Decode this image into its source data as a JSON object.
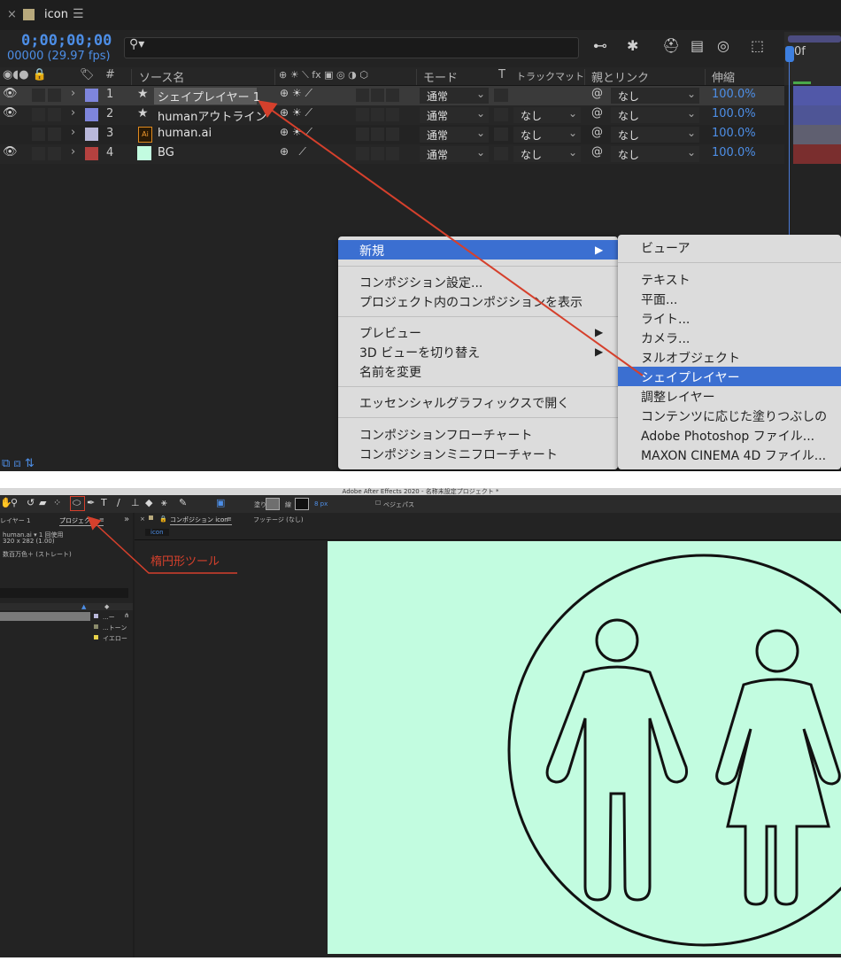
{
  "top_panel": {
    "tab": {
      "close": "×",
      "title": "icon",
      "menu": "☰"
    },
    "timecode": "0;00;00;00",
    "fps": "00000 (29.97 fps)",
    "search_placeholder": "",
    "timeline_label": "0f",
    "columns": {
      "switch_icons": "◉◖● 🔒",
      "label_icon": "🏷",
      "hash": "#",
      "source_name": "ソース名",
      "switches": "⊕ ☀ ⟍ fx ▣ ◎ ◑ ⬡",
      "mode": "モード",
      "t": "T",
      "track_matte": "トラックマット",
      "parent": "親とリンク",
      "stretch": "伸縮"
    },
    "layers": [
      {
        "num": "1",
        "name": "シェイプレイヤー 1",
        "type_icon": "★",
        "label_color": "#7e85dc",
        "mode": "通常",
        "matte": "",
        "parent": "なし",
        "stretch": "100.0%",
        "visible": true
      },
      {
        "num": "2",
        "name": "humanアウトライン",
        "type_icon": "★",
        "label_color": "#7e85dc",
        "mode": "通常",
        "matte": "なし",
        "parent": "なし",
        "stretch": "100.0%",
        "visible": true
      },
      {
        "num": "3",
        "name": "human.ai",
        "type_icon": "Ai",
        "label_color": "#b9b8da",
        "mode": "通常",
        "matte": "なし",
        "parent": "なし",
        "stretch": "100.0%",
        "visible": false
      },
      {
        "num": "4",
        "name": "BG",
        "type_icon": "■",
        "label_color": "#b4413f",
        "mode": "通常",
        "matte": "なし",
        "parent": "なし",
        "stretch": "100.0%",
        "visible": true
      }
    ],
    "context_menu": {
      "items": [
        "新規",
        "コンポジション設定...",
        "プロジェクト内のコンポジションを表示",
        "プレビュー",
        "3D ビューを切り替え",
        "名前を変更",
        "エッセンシャルグラフィックスで開く",
        "コンポジションフローチャート",
        "コンポジションミニフローチャート"
      ],
      "submenu_arrow": "▶"
    },
    "submenu": {
      "items": [
        "ビューア",
        "テキスト",
        "平面...",
        "ライト...",
        "カメラ...",
        "ヌルオブジェクト",
        "シェイプレイヤー",
        "調整レイヤー",
        "コンテンツに応じた塗りつぶしの",
        "Adobe Photoshop ファイル...",
        "MAXON CINEMA 4D ファイル..."
      ]
    }
  },
  "bottom_panel": {
    "app_title": "Adobe After Effects 2020 - 名称未設定プロジェクト *",
    "toolbar": {
      "fill_label": "塗り",
      "stroke_label": "線",
      "stroke_width": "8 px",
      "bezier_label": "ベジェパス"
    },
    "left_tabs": {
      "layer": "レイヤー 1",
      "project": "プロジェクト",
      "menu": "≡",
      "expand": "»"
    },
    "project_info": {
      "item": "human.ai ▾  1 回使用",
      "size": "320 x 282 (1.00)",
      "color": "数百万色＋ (ストレート)"
    },
    "project_items": [
      "...ー",
      "...トーン",
      "イエロー"
    ],
    "comp_tabs": {
      "close": "×",
      "comp": "コンポジション icon",
      "menu": "≡",
      "footage": "フッテージ (なし)",
      "breadcrumb": "icon"
    },
    "annotation": "楕円形ツール",
    "colors": {
      "canvas": "#c2fce0",
      "accent": "#d5402c",
      "highlight": "#3b6fd1",
      "timecode": "#4d8ee6"
    }
  }
}
